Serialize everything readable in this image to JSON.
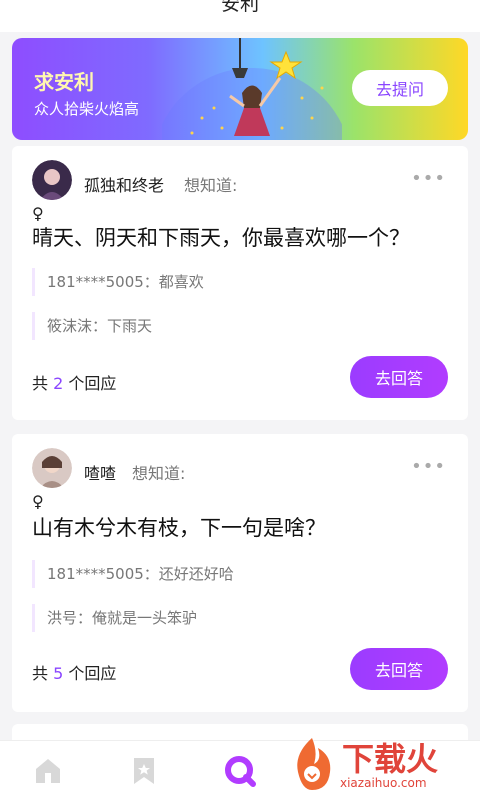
{
  "header": {
    "title": "安利"
  },
  "banner": {
    "title": "求安利",
    "subtitle": "众人拾柴火焰高",
    "ask_label": "去提问"
  },
  "questions": [
    {
      "username": "孤独和终老",
      "wants": "想知道:",
      "question": "晴天、阴天和下雨天，你最喜欢哪一个？",
      "replies": [
        "181****5005：都喜欢",
        "筱沫沫：下雨天"
      ],
      "count_prefix": "共",
      "count": "2",
      "count_suffix": "个回应",
      "answer_label": "去回答"
    },
    {
      "username": "喳喳",
      "wants": "想知道:",
      "question": "山有木兮木有枝，下一句是啥？",
      "replies": [
        "181****5005：还好还好哈",
        "洪号：俺就是一头笨驴"
      ],
      "count_prefix": "共",
      "count": "5",
      "count_suffix": "个回应",
      "answer_label": "去回答"
    }
  ],
  "more_glyph": "•••",
  "tabbar": {
    "icons": [
      "home-icon",
      "bookmark-icon",
      "search-q-icon"
    ]
  },
  "watermark": {
    "text": "下载火",
    "url": "xiazaihuo.com"
  },
  "colors": {
    "accent": "#8a45ff",
    "banner_start": "#8e4dff",
    "banner_end": "#ffd826",
    "watermark": "#e0443a"
  }
}
